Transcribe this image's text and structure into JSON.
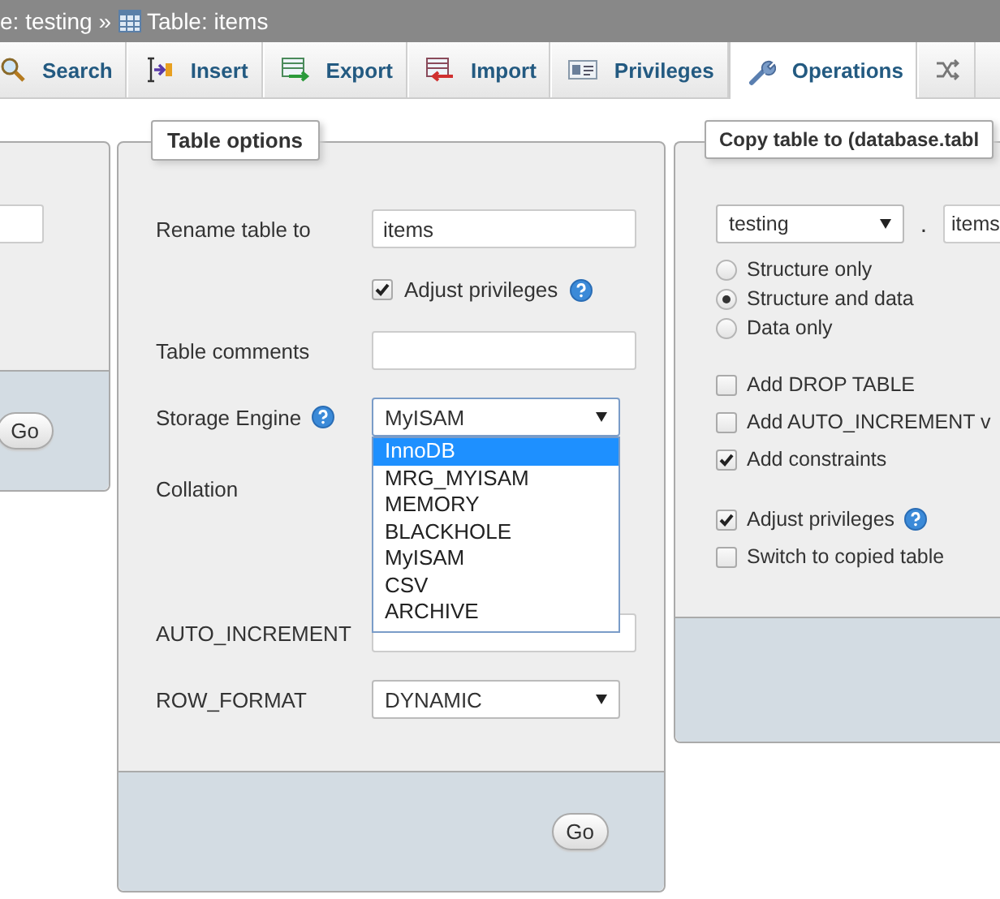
{
  "breadcrumb": {
    "prefix": "e: testing »",
    "table": "Table: items"
  },
  "tabs": [
    {
      "label": "Search",
      "selected": false
    },
    {
      "label": "Insert",
      "selected": false
    },
    {
      "label": "Export",
      "selected": false
    },
    {
      "label": "Import",
      "selected": false
    },
    {
      "label": "Privileges",
      "selected": false
    },
    {
      "label": "Operations",
      "selected": true
    },
    {
      "selected": false
    }
  ],
  "left_panel": {
    "button": "Go"
  },
  "table_options": {
    "legend": "Table options",
    "rows": [
      {
        "kind": "text",
        "label": "Rename table to",
        "value": "items"
      },
      {
        "kind": "checkbox",
        "label": "Adjust privileges",
        "checked": true,
        "help": true
      },
      {
        "kind": "text",
        "label": "Table comments"
      },
      {
        "kind": "select",
        "label": "Storage Engine",
        "help": true,
        "value": "MyISAM",
        "expanded": true,
        "options": [
          {
            "label": "InnoDB",
            "highlighted": true
          },
          {
            "label": "MRG_MYISAM",
            "highlighted": false
          },
          {
            "label": "MEMORY",
            "highlighted": false
          },
          {
            "label": "BLACKHOLE",
            "highlighted": false
          },
          {
            "label": "MyISAM",
            "highlighted": false
          },
          {
            "label": "CSV",
            "highlighted": false
          },
          {
            "label": "ARCHIVE",
            "highlighted": false
          }
        ]
      },
      {
        "kind": "blank",
        "label": "Collation"
      },
      {
        "kind": "text",
        "label": "AUTO_INCREMENT"
      },
      {
        "kind": "select",
        "label": "ROW_FORMAT",
        "value": "DYNAMIC",
        "expanded": false
      }
    ],
    "button": "Go"
  },
  "copy_table": {
    "legend": "Copy table to (database.tabl",
    "database": "testing",
    "separator": ".",
    "table": "items",
    "modes": [
      {
        "label": "Structure only",
        "selected": false
      },
      {
        "label": "Structure and data",
        "selected": true
      },
      {
        "label": "Data only",
        "selected": false
      }
    ],
    "options": [
      {
        "label": "Add DROP TABLE",
        "checked": false
      },
      {
        "label": "Add AUTO_INCREMENT v",
        "checked": false
      },
      {
        "label": "Add constraints",
        "checked": true
      }
    ],
    "options_2": [
      {
        "label": "Adjust privileges",
        "checked": true,
        "help": true
      },
      {
        "label": "Switch to copied table",
        "checked": false
      }
    ]
  }
}
